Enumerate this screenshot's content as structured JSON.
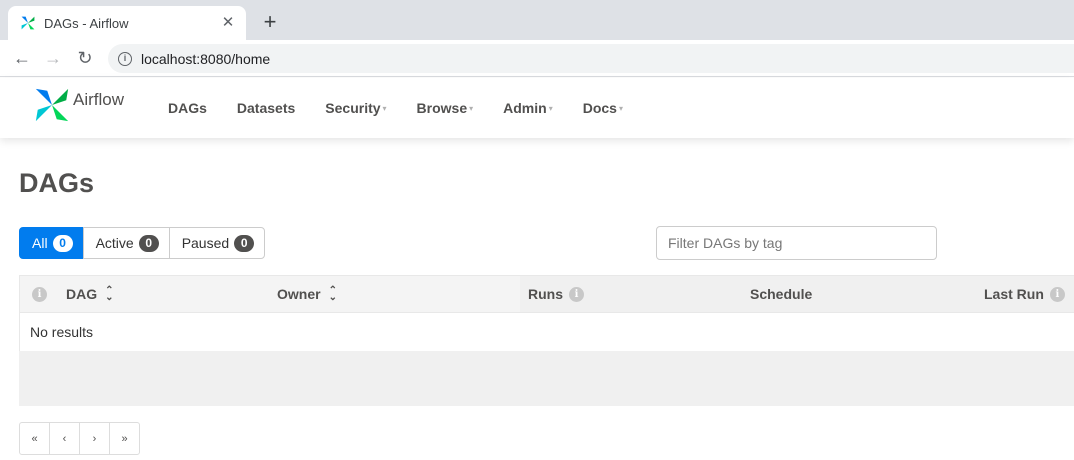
{
  "browser": {
    "tab_title": "DAGs - Airflow",
    "close_glyph": "✕",
    "new_tab_glyph": "+",
    "back_glyph": "←",
    "forward_glyph": "→",
    "reload_glyph": "↻",
    "url": "localhost:8080/home",
    "info_glyph": "i"
  },
  "navbar": {
    "brand": "Airflow",
    "items": [
      {
        "label": "DAGs",
        "dropdown": false
      },
      {
        "label": "Datasets",
        "dropdown": false
      },
      {
        "label": "Security",
        "dropdown": true
      },
      {
        "label": "Browse",
        "dropdown": true
      },
      {
        "label": "Admin",
        "dropdown": true
      },
      {
        "label": "Docs",
        "dropdown": true
      }
    ],
    "caret": "▾"
  },
  "page": {
    "title": "DAGs"
  },
  "filters": [
    {
      "label": "All",
      "count": "0",
      "active": true
    },
    {
      "label": "Active",
      "count": "0",
      "active": false
    },
    {
      "label": "Paused",
      "count": "0",
      "active": false
    }
  ],
  "tag_filter": {
    "placeholder": "Filter DAGs by tag"
  },
  "table": {
    "info_glyph": "i",
    "sort_up": "⌃",
    "sort_down": "⌄",
    "columns": {
      "dag": "DAG",
      "owner": "Owner",
      "runs": "Runs",
      "schedule": "Schedule",
      "last_run": "Last Run"
    },
    "empty_message": "No results"
  },
  "pagination": {
    "first": "«",
    "prev": "‹",
    "next": "›",
    "last": "»"
  },
  "colors": {
    "accent": "#017cee",
    "text": "#51504f"
  }
}
